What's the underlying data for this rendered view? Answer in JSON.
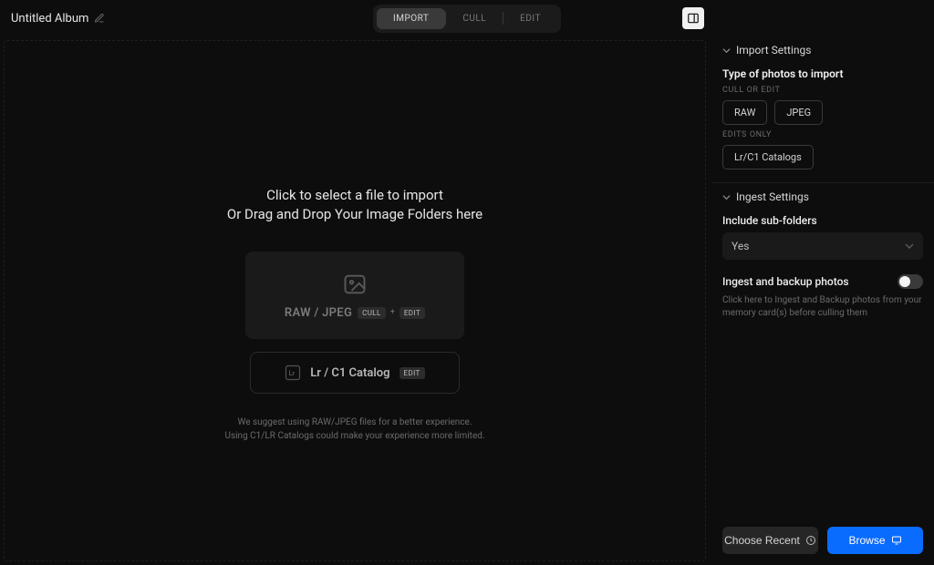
{
  "header": {
    "album_title": "Untitled Album",
    "nav": {
      "import": "IMPORT",
      "cull": "CULL",
      "edit": "EDIT"
    }
  },
  "canvas": {
    "instr1": "Click to select a file to import",
    "instr2": "Or Drag and Drop Your Image Folders here",
    "dropzone": {
      "label": "RAW / JPEG",
      "chip_cull": "CULL",
      "chip_plus": "+",
      "chip_edit": "EDIT"
    },
    "catalogzone": {
      "label": "Lr / C1 Catalog",
      "chip_edit": "EDIT"
    },
    "suggest1": "We suggest using RAW/JPEG files for a better experience.",
    "suggest2": "Using C1/LR Catalogs could make your experience more limited."
  },
  "right": {
    "import_settings": {
      "title": "Import Settings",
      "type_label": "Type of photos to import",
      "cull_or_edit": "CULL OR EDIT",
      "raw": "RAW",
      "jpeg": "JPEG",
      "edits_only": "EDITS ONLY",
      "catalogs": "Lr/C1 Catalogs"
    },
    "ingest_settings": {
      "title": "Ingest Settings",
      "include_subfolders": "Include sub-folders",
      "select_value": "Yes",
      "toggle_label": "Ingest and backup photos",
      "toggle_help": "Click here to Ingest and Backup photos from your memory card(s) before culling them"
    },
    "footer": {
      "choose_recent": "Choose Recent",
      "browse": "Browse"
    }
  }
}
